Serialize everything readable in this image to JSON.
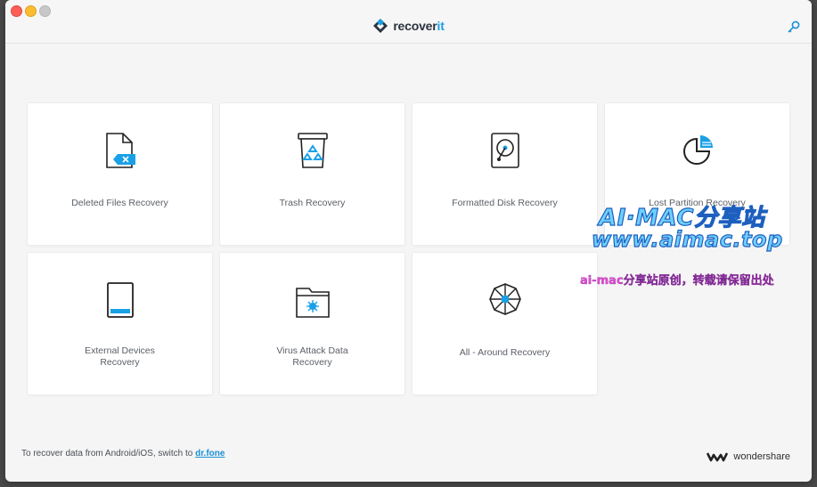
{
  "window": {
    "brand": {
      "name_main": "recover",
      "name_accent": "it"
    }
  },
  "cards": [
    {
      "label": "Deleted Files Recovery",
      "icon": "deleted-file-icon"
    },
    {
      "label": "Trash Recovery",
      "icon": "trash-bin-icon"
    },
    {
      "label": "Formatted Disk Recovery",
      "icon": "hard-disk-icon"
    },
    {
      "label": "Lost Partition Recovery",
      "icon": "partition-pie-icon"
    },
    {
      "label": "External Devices Recovery",
      "label_line1": "External Devices",
      "label_line2": "Recovery",
      "icon": "external-device-icon"
    },
    {
      "label": "Virus Attack Data Recovery",
      "label_line1": "Virus Attack Data",
      "label_line2": "Recovery",
      "icon": "virus-folder-icon"
    },
    {
      "label": "All - Around Recovery",
      "icon": "all-around-wheel-icon"
    }
  ],
  "footer": {
    "prefix": "To recover data from Android/iOS, switch to ",
    "link": "dr.fone",
    "company": "wondershare"
  },
  "watermark": {
    "line1": "AI·MAC分享站",
    "line2": "www.aimac.top",
    "line3": "ai-mac分享站原创，转载请保留出处"
  },
  "colors": {
    "accent": "#1aa0e6",
    "brand_dark": "#2b3340",
    "background": "#f5f5f5"
  }
}
